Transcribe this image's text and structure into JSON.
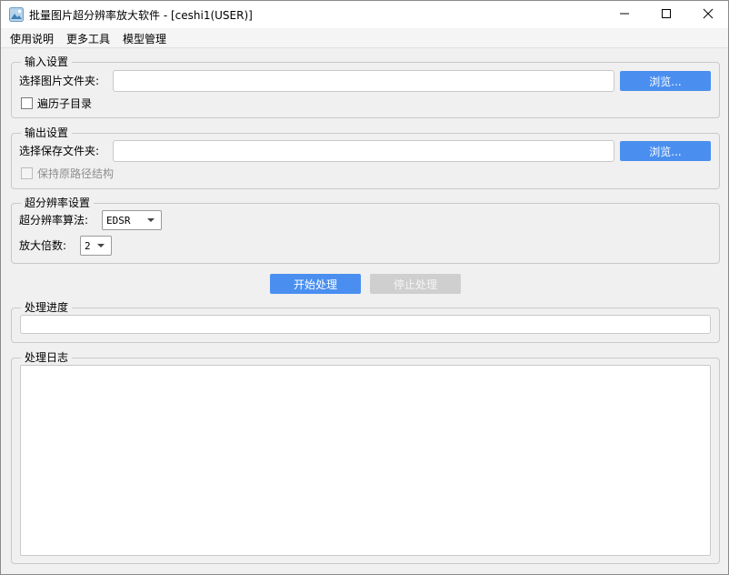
{
  "window": {
    "title": "批量图片超分辨率放大软件 - [ceshi1(USER)]",
    "icons": {
      "app": "image-app-icon",
      "minimize": "minimize-icon",
      "maximize": "maximize-icon",
      "close": "close-icon"
    }
  },
  "menu": [
    "使用说明",
    "更多工具",
    "模型管理"
  ],
  "input_settings": {
    "title": "输入设置",
    "folder_label": "选择图片文件夹:",
    "folder_value": "",
    "browse_label": "浏览...",
    "recursive_label": "遍历子目录",
    "recursive_checked": false
  },
  "output_settings": {
    "title": "输出设置",
    "folder_label": "选择保存文件夹:",
    "folder_value": "",
    "browse_label": "浏览...",
    "keep_structure_label": "保持原路径结构",
    "keep_structure_checked": false,
    "keep_structure_enabled": false
  },
  "sr_settings": {
    "title": "超分辨率设置",
    "algorithm_label": "超分辨率算法:",
    "algorithm_value": "EDSR",
    "scale_label": "放大倍数:",
    "scale_value": "2"
  },
  "actions": {
    "start_label": "开始处理",
    "stop_label": "停止处理",
    "stop_enabled": false
  },
  "progress": {
    "title": "处理进度",
    "percent": 0
  },
  "log": {
    "title": "处理日志",
    "content": ""
  },
  "colors": {
    "accent": "#4a8ff0",
    "disabled_button": "#cfcfcf"
  }
}
